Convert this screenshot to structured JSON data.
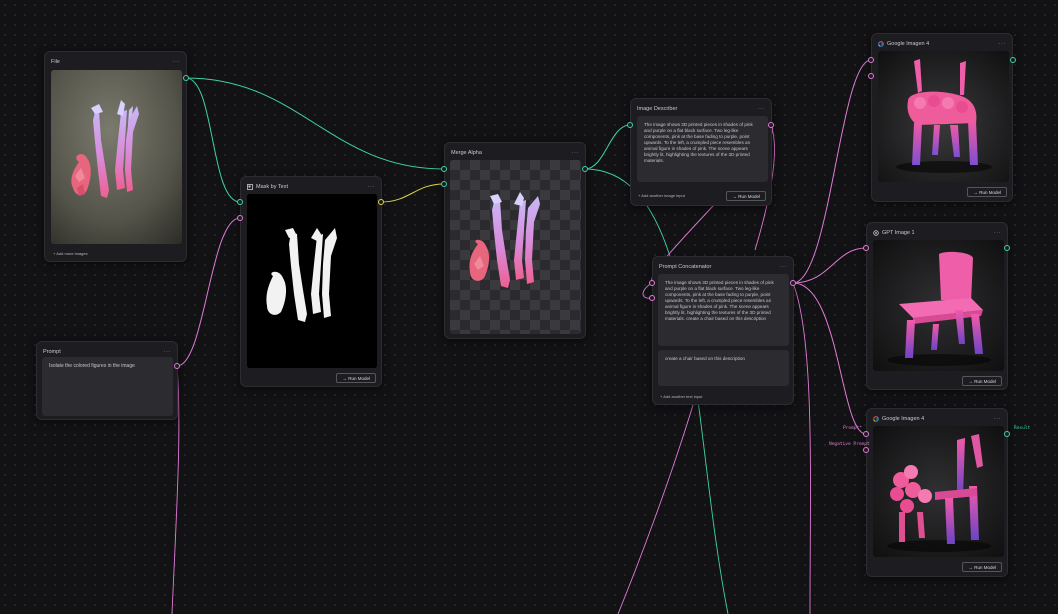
{
  "colors": {
    "image_wire": "#3fd3a4",
    "text_wire": "#e07ad6",
    "mask_wire": "#d9d44a",
    "node_bg": "#1d1d21"
  },
  "nodes": {
    "file": {
      "title": "File",
      "menu": "···",
      "add_more": "+ Add more images"
    },
    "prompt": {
      "title": "Prompt",
      "menu": "···",
      "text": "Isolate the colored figures in the image"
    },
    "mask_by_text": {
      "title": "Mask by Text",
      "icon": "mask-icon",
      "menu": "···",
      "run": "→ Run Model"
    },
    "merge_alpha": {
      "title": "Merge Alpha",
      "menu": "···"
    },
    "image_describer": {
      "title": "Image Describer",
      "menu": "···",
      "text": "The image shows 3D printed pieces in shades of pink and purple on a flat black surface. Two leg-like components, pink at the base fading to purple, point upwards. To the left, a crumpled piece resembles an animal figure in shades of pink. The scene appears brightly lit, highlighting the textures of the 3D printed materials.",
      "add_input": "+ Add another image input",
      "run": "→ Run Model"
    },
    "prompt_concatenator": {
      "title": "Prompt Concatenator",
      "menu": "···",
      "text": "The image shows 3D printed pieces in shades of pink and purple on a flat black surface. Two leg-like components, pink at the base fading to purple, point upwards. To the left, a crumpled piece resembles an animal figure in shades of pink. The scene appears brightly lit, highlighting the textures of the 3D printed materials. create a chair based on this description",
      "extra_text": "create a chair based on this description",
      "add_input": "+ Add another text input"
    },
    "google_imagen_top": {
      "title": "Google Imagen 4",
      "icon": "google-icon",
      "menu": "···",
      "run": "→ Run Model"
    },
    "gpt_image": {
      "title": "GPT Image 1",
      "icon": "openai-icon",
      "menu": "···",
      "run": "→ Run Model"
    },
    "google_imagen_bottom": {
      "title": "Google Imagen 4",
      "icon": "google-icon",
      "menu": "···",
      "run": "→ Run Model",
      "port_prompt": "Prompt*",
      "port_negative": "Negative Prompt",
      "port_result": "Result"
    }
  }
}
